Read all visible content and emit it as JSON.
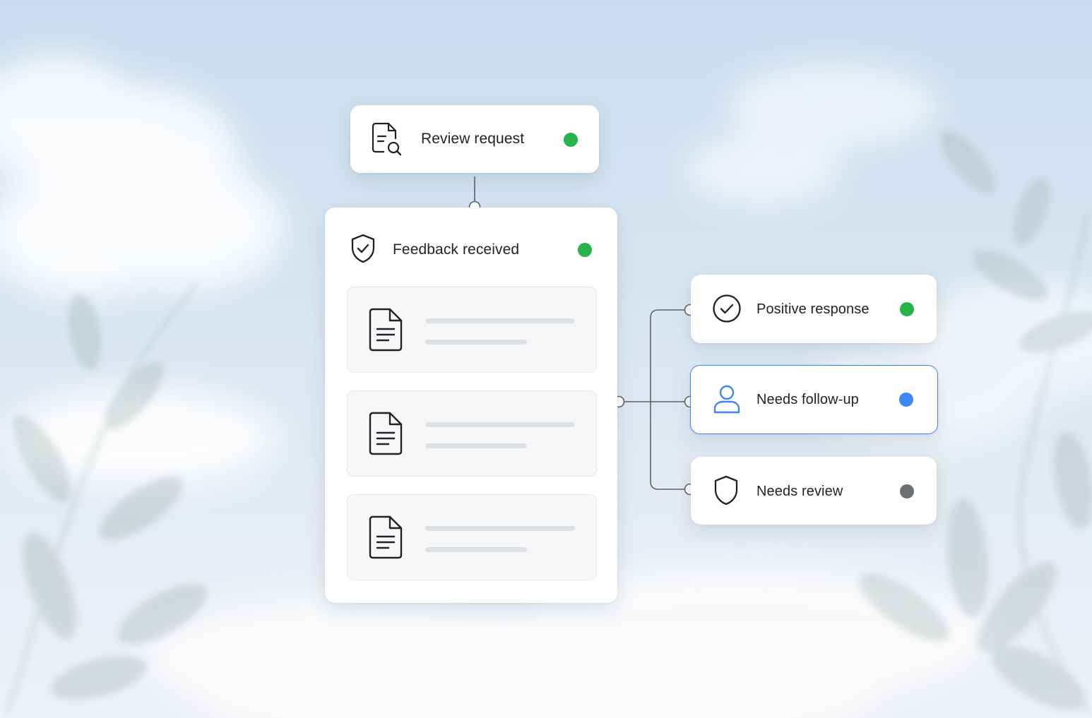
{
  "nodes": {
    "review_request": {
      "label": "Review request",
      "status_color": "#27b34a",
      "icon": "file-search-icon"
    },
    "feedback_received": {
      "label": "Feedback received",
      "status_color": "#27b34a",
      "icon": "shield-check-icon",
      "documents": [
        {
          "icon": "document-icon"
        },
        {
          "icon": "document-icon"
        },
        {
          "icon": "document-icon"
        }
      ]
    },
    "positive_response": {
      "label": "Positive response",
      "status_color": "#27b34a",
      "icon": "check-circle-icon"
    },
    "needs_follow_up": {
      "label": "Needs follow-up",
      "status_color": "#3d86f5",
      "icon": "user-icon",
      "highlighted": true,
      "accent": "#3d86f5"
    },
    "needs_review": {
      "label": "Needs review",
      "status_color": "#6b6e72",
      "icon": "shield-icon"
    }
  }
}
